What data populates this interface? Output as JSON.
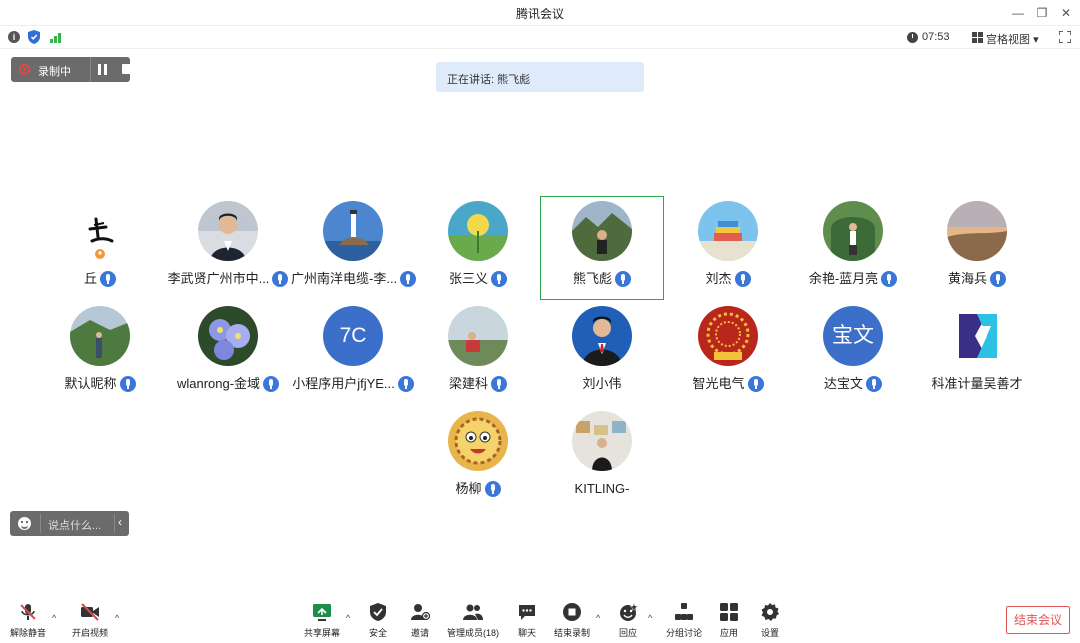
{
  "window": {
    "title": "腾讯会议"
  },
  "infobar": {
    "timer": "07:53",
    "view_label": "宫格视图"
  },
  "recording": {
    "label": "录制中"
  },
  "speaking": {
    "text": "正在讲话: 熊飞彪"
  },
  "participants": [
    {
      "name": "丘",
      "avatar": "handwriting-logo",
      "mic": true
    },
    {
      "name": "李武贤广州市中...",
      "avatar": "photo",
      "mic": true
    },
    {
      "name": "广州南洋电缆-李...",
      "avatar": "photo",
      "mic": true
    },
    {
      "name": "张三义",
      "avatar": "photo",
      "mic": true
    },
    {
      "name": "熊飞彪",
      "avatar": "photo",
      "mic": true,
      "speaking": true
    },
    {
      "name": "刘杰",
      "avatar": "photo",
      "mic": true
    },
    {
      "name": "余艳-蓝月亮",
      "avatar": "photo",
      "mic": true
    },
    {
      "name": "黄海兵",
      "avatar": "photo",
      "mic": true
    },
    {
      "name": "默认昵称",
      "avatar": "photo",
      "mic": true
    },
    {
      "name": "wlanrong-金域",
      "avatar": "photo",
      "mic": true
    },
    {
      "name": "小程序用户jfjYE...",
      "avatar": "text",
      "initials": "7C",
      "mic": true
    },
    {
      "name": "梁建科",
      "avatar": "photo",
      "mic": true
    },
    {
      "name": "刘小伟",
      "avatar": "photo",
      "mic": false
    },
    {
      "name": "智光电气",
      "avatar": "photo",
      "mic": true
    },
    {
      "name": "达宝文",
      "avatar": "text",
      "initials": "宝文",
      "mic": true
    },
    {
      "name": "科准计量吴善才",
      "avatar": "logo",
      "mic": false
    },
    {
      "name": "杨柳",
      "avatar": "photo",
      "mic": true
    },
    {
      "name": "KITLING-",
      "avatar": "photo",
      "mic": false
    }
  ],
  "chat": {
    "placeholder": "说点什么..."
  },
  "toolbar": {
    "unmute": "解除静音",
    "start_video": "开启视频",
    "share_screen": "共享屏幕",
    "security": "安全",
    "invite": "邀请",
    "members": "管理成员(18)",
    "chat": "聊天",
    "stop_recording": "结束录制",
    "reactions": "回应",
    "breakout": "分组讨论",
    "apps": "应用",
    "settings": "设置",
    "end_meeting": "结束会议"
  },
  "colors": {
    "accent": "#3a77d8",
    "speaking_border": "#2aa84a",
    "end_red": "#e35656",
    "avatar_blue": "#3c6fc9"
  }
}
